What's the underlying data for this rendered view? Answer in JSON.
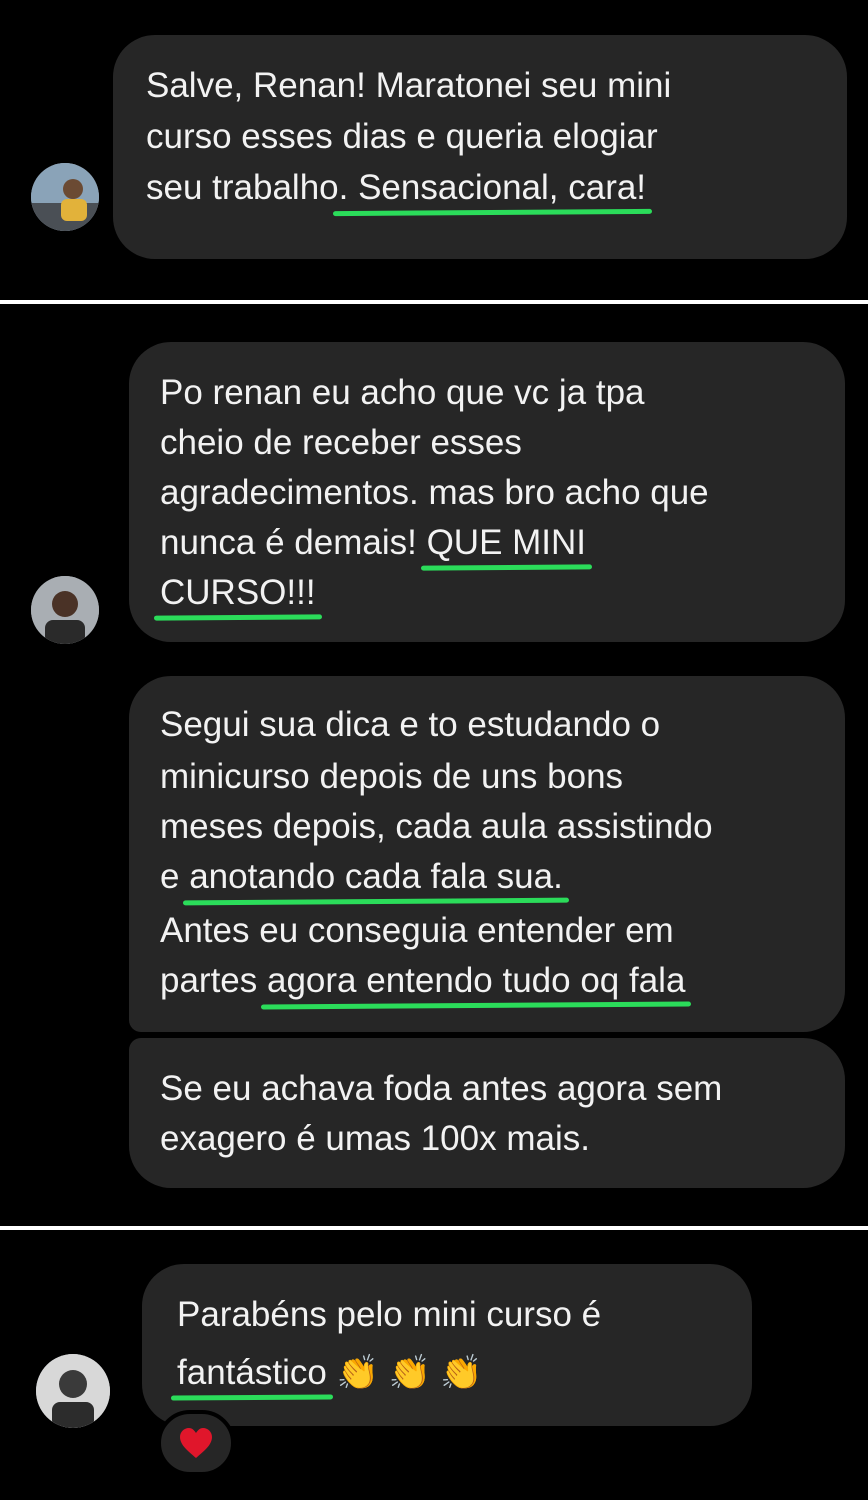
{
  "messages": [
    {
      "lines": [
        {
          "pre": "Salve, Renan! Maratonei seu mini",
          "hl": ""
        },
        {
          "pre": "curso esses dias e queria elogiar",
          "hl": ""
        },
        {
          "pre": "seu trabalho",
          "hl": ". Sensacional, cara!"
        }
      ]
    },
    {
      "lines": [
        {
          "pre": "Po renan eu acho que vc ja tpa",
          "hl": ""
        },
        {
          "pre": "cheio de receber esses",
          "hl": ""
        },
        {
          "pre": "agradecimentos. mas bro acho que",
          "hl": ""
        },
        {
          "pre": "nunca é demais! ",
          "hl": "QUE MINI"
        },
        {
          "pre": "",
          "hl": "CURSO!!!"
        }
      ]
    },
    {
      "lines": [
        {
          "pre": "Segui sua dica e to estudando o",
          "hl": ""
        },
        {
          "pre": "minicurso depois de uns bons",
          "hl": ""
        },
        {
          "pre": "meses depois, cada aula assistindo",
          "hl": ""
        },
        {
          "pre": "e ",
          "hl": "anotando cada fala sua."
        },
        {
          "pre": "Antes eu conseguia entender em",
          "hl": ""
        },
        {
          "pre": "partes ",
          "hl": "agora entendo tudo oq fala"
        }
      ]
    },
    {
      "lines": [
        {
          "pre": "Se eu achava foda antes agora sem",
          "hl": ""
        },
        {
          "pre": "exagero é umas 100x mais.",
          "hl": ""
        }
      ]
    },
    {
      "lines": [
        {
          "pre": "Parabéns pelo mini curso é",
          "hl": ""
        },
        {
          "pre": "",
          "hl": "fantástico",
          "emoji": "👏 👏 👏"
        }
      ],
      "reaction": "heart-emoji"
    }
  ],
  "colors": {
    "background": "#000000",
    "bubble": "#262626",
    "text": "#f2f2f2",
    "highlight": "#2bdc5a",
    "divider": "#ffffff"
  }
}
